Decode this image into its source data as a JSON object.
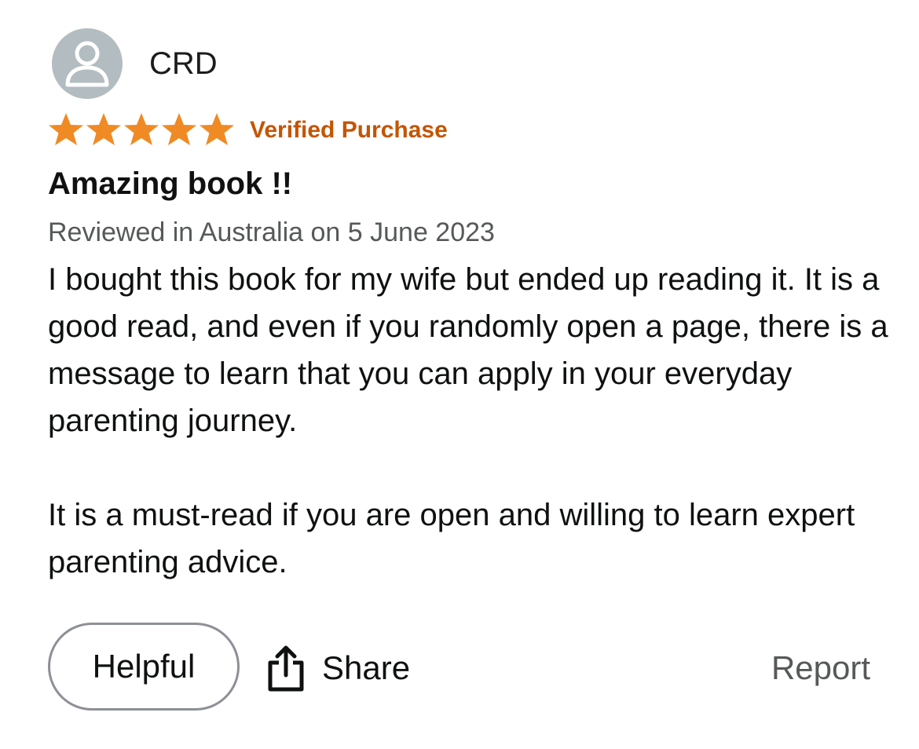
{
  "review": {
    "author": "CRD",
    "avatar_icon": "default-user-icon",
    "rating": 5,
    "rating_max": 5,
    "star_color": "#f08a24",
    "badge": "Verified Purchase",
    "badge_color": "#c45500",
    "title": "Amazing book !!",
    "meta": "Reviewed in Australia on 5 June 2023",
    "body": [
      "I bought this book for my wife but ended up reading it. It is a good read, and even if you randomly open a page, there is a message to learn that you can apply in your everyday parenting journey.",
      "It is a must-read if you are open and willing to learn expert parenting advice."
    ]
  },
  "actions": {
    "helpful_label": "Helpful",
    "share_label": "Share",
    "share_icon": "share-icon",
    "report_label": "Report"
  }
}
